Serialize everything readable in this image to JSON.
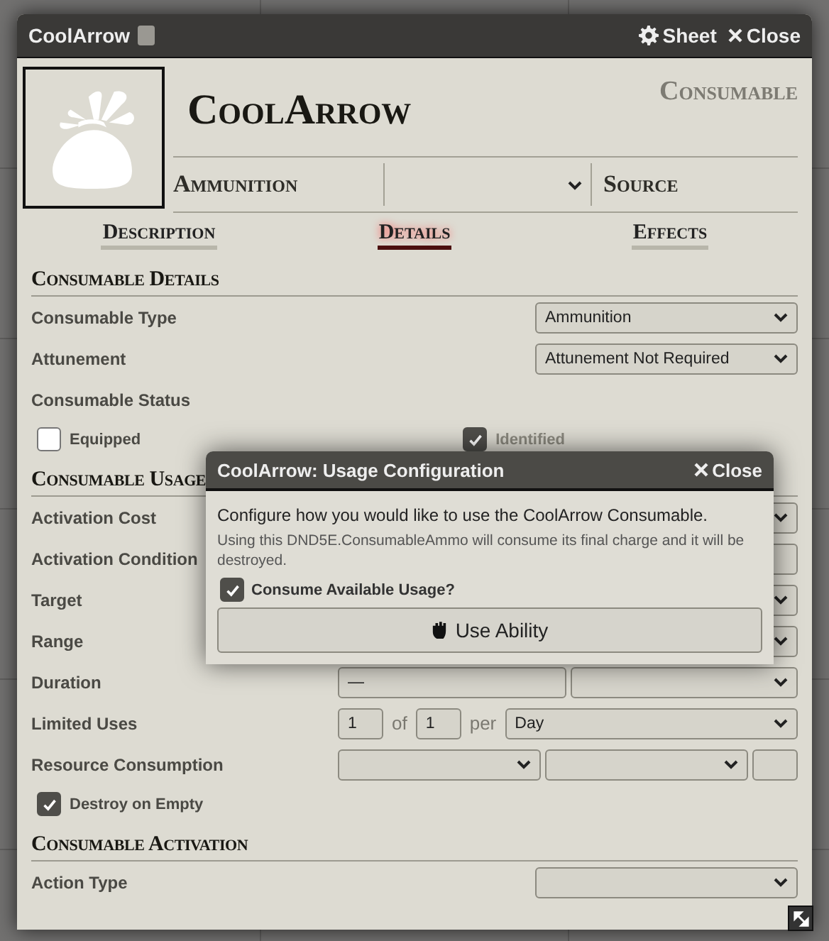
{
  "window": {
    "title": "CoolArrow",
    "header_buttons": [
      {
        "kind": "sheet",
        "label": "Sheet"
      },
      {
        "kind": "close",
        "label": "Close"
      }
    ]
  },
  "item": {
    "name": "CoolArrow",
    "type": "Consumable",
    "subtype": "Ammunition",
    "source": "Source"
  },
  "tabs": [
    {
      "label": "Description",
      "selected": false
    },
    {
      "label": "Details",
      "selected": true
    },
    {
      "label": "Effects",
      "selected": false
    }
  ],
  "sections": [
    {
      "title": "Consumable Details",
      "rows": [
        {
          "kind": "field",
          "label": "Consumable Type",
          "controls": [
            {
              "kind": "select",
              "value": "Ammunition"
            }
          ]
        },
        {
          "kind": "field",
          "label": "Attunement",
          "controls": [
            {
              "kind": "select",
              "value": "Attunement Not Required"
            }
          ]
        },
        {
          "kind": "field",
          "label": "Consumable Status"
        },
        {
          "kind": "checkboxes",
          "items": [
            {
              "label": "Equipped",
              "checked": false
            },
            {
              "label": "Identified",
              "checked": true
            }
          ]
        }
      ]
    },
    {
      "title": "Consumable Usage",
      "rows": [
        {
          "kind": "field",
          "label": "Activation Cost",
          "controls": [
            {
              "kind": "select"
            }
          ]
        },
        {
          "kind": "field",
          "label": "Activation Condition",
          "controls": [
            {
              "kind": "input"
            }
          ]
        },
        {
          "kind": "field",
          "label": "Target",
          "controls": [
            {
              "kind": "select"
            }
          ]
        },
        {
          "kind": "field",
          "label": "Range",
          "controls": [
            {
              "kind": "select"
            }
          ]
        },
        {
          "kind": "field",
          "label": "Duration",
          "controls": [
            {
              "kind": "input",
              "value": "—"
            },
            {
              "kind": "select"
            }
          ]
        },
        {
          "kind": "field",
          "label": "Limited Uses",
          "controls": [
            {
              "kind": "number",
              "value": "1"
            },
            {
              "kind": "word",
              "value": "of"
            },
            {
              "kind": "number",
              "value": "1"
            },
            {
              "kind": "word",
              "value": "per"
            },
            {
              "kind": "select",
              "value": "Day"
            }
          ]
        },
        {
          "kind": "field",
          "label": "Resource Consumption",
          "controls": [
            {
              "kind": "select"
            },
            {
              "kind": "select"
            },
            {
              "kind": "number"
            }
          ]
        },
        {
          "kind": "checkboxes",
          "items": [
            {
              "label": "Destroy on Empty",
              "checked": true
            }
          ]
        }
      ]
    },
    {
      "title": "Consumable Activation",
      "rows": [
        {
          "kind": "field",
          "label": "Action Type",
          "controls": [
            {
              "kind": "select"
            }
          ]
        }
      ]
    }
  ],
  "dialog": {
    "title": "CoolArrow: Usage Configuration",
    "close": "Close",
    "message": "Configure how you would like to use the CoolArrow Consumable.",
    "note": "Using this DND5E.ConsumableAmmo will consume its final charge and it will be destroyed.",
    "checkbox": {
      "label": "Consume Available Usage?",
      "checked": true
    },
    "button": "Use Ability"
  }
}
